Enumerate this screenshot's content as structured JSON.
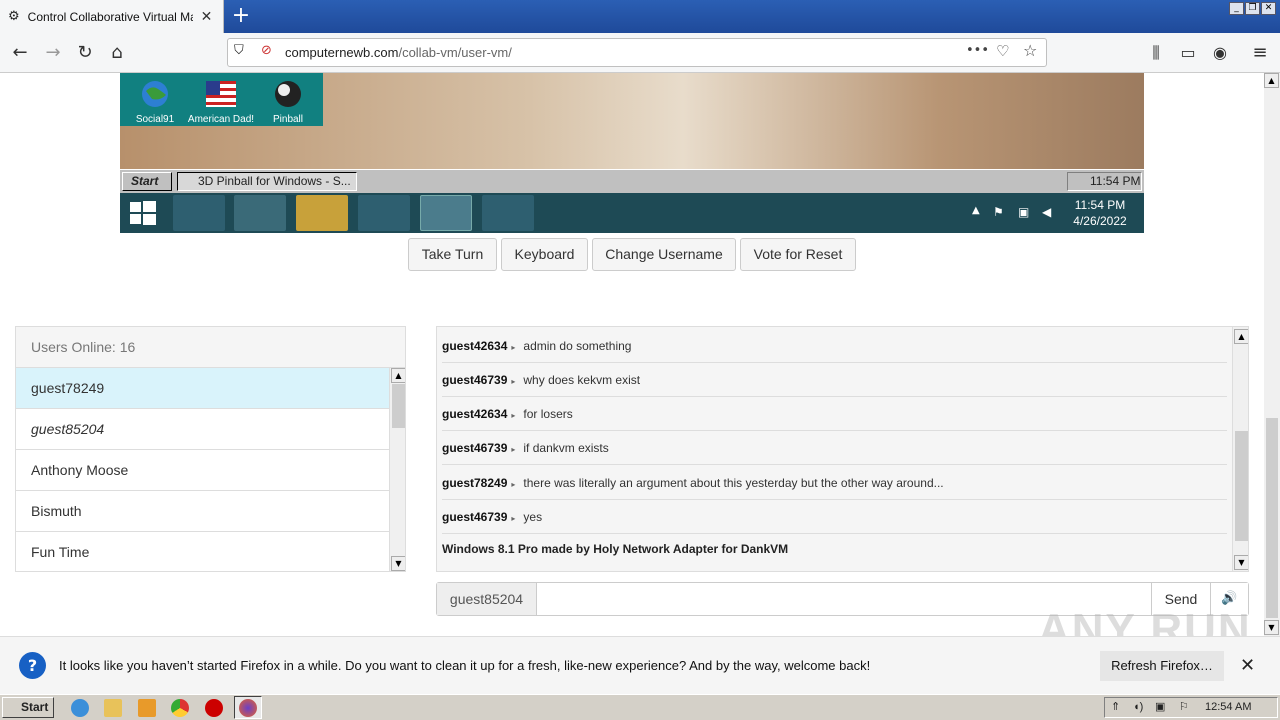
{
  "browser": {
    "tab_title": "Control Collaborative Virtual Machi",
    "url_host": "computernewb.com",
    "url_path": "/collab-vm/user-vm/",
    "url_menu": "•••"
  },
  "vm": {
    "desktop_icons": [
      "Social91",
      "American Dad!",
      "Pinball"
    ],
    "w98_start": "Start",
    "w98_task": "3D Pinball for Windows - S...",
    "w98_clock": "11:54 PM",
    "w8_time": "11:54 PM",
    "w8_date": "4/26/2022"
  },
  "controls": {
    "take_turn": "Take Turn",
    "keyboard": "Keyboard",
    "change_username": "Change Username",
    "vote_reset": "Vote for Reset"
  },
  "users": {
    "header": "Users Online: 16",
    "list": [
      "guest78249",
      "guest85204",
      "Anthony Moose",
      "Bismuth",
      "Fun Time"
    ]
  },
  "chat": {
    "messages": [
      {
        "user": "guest42634",
        "text": "admin do something"
      },
      {
        "user": "guest46739",
        "text": "why does kekvm exist"
      },
      {
        "user": "guest42634",
        "text": "for losers"
      },
      {
        "user": "guest46739",
        "text": "if dankvm exists"
      },
      {
        "user": "guest78249",
        "text": "there was literally an argument about this yesterday but the other way around..."
      },
      {
        "user": "guest46739",
        "text": "yes"
      }
    ],
    "system": "Windows 8.1 Pro made by Holy Network Adapter for DankVM",
    "username": "guest85204",
    "send": "Send"
  },
  "notification": {
    "text": "It looks like you haven’t started Firefox in a while. Do you want to clean it up for a fresh, like-new experience? And by the way, welcome back!",
    "button": "Refresh Firefox…"
  },
  "watermark": "ANY RUN",
  "taskbar": {
    "start": "Start",
    "clock": "12:54 AM"
  },
  "colors": {
    "accent": "#2b5fb4",
    "highlight": "#d9f3fb"
  }
}
